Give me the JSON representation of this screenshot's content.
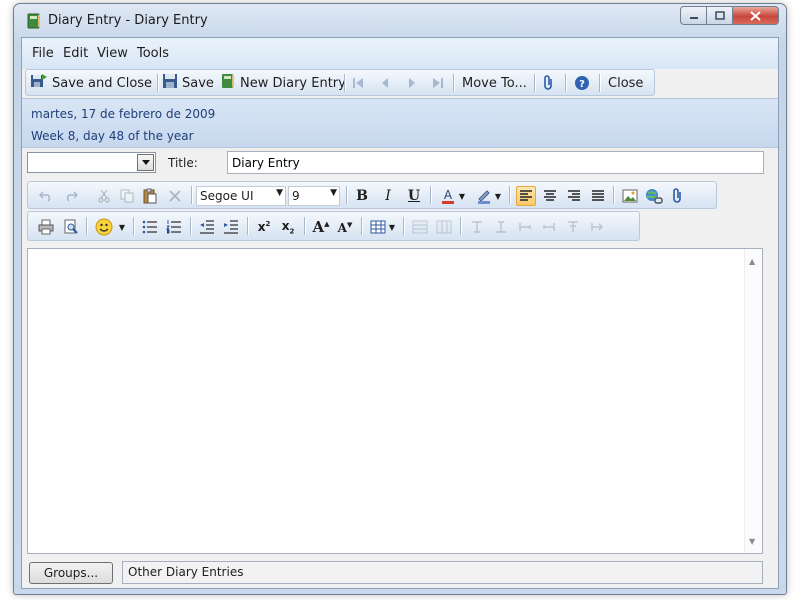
{
  "window": {
    "title": "Diary Entry - Diary Entry"
  },
  "menu": {
    "file": "File",
    "edit": "Edit",
    "view": "View",
    "tools": "Tools"
  },
  "toolbar": {
    "save_and_close": "Save and Close",
    "save": "Save",
    "new_diary_entry": "New Diary Entry",
    "move_to": "Move To...",
    "close": "Close"
  },
  "info": {
    "date": "martes, 17 de febrero de 2009",
    "week": "Week 8, day 48 of the year"
  },
  "form": {
    "category_value": "",
    "title_label": "Title:",
    "title_value": "Diary Entry"
  },
  "format": {
    "font_name": "Segoe UI",
    "font_size": "9"
  },
  "footer": {
    "groups_button": "Groups...",
    "groups_value": "Other Diary Entries"
  },
  "colors": {
    "accent": "#1f3f7a",
    "font_color": "#d23a2a",
    "active_align": "#f8c966"
  },
  "icons": [
    "diary-book-icon",
    "save-close-icon",
    "save-icon",
    "new-entry-icon",
    "first-icon",
    "prev-icon",
    "next-icon",
    "last-icon",
    "paperclip-icon",
    "help-icon",
    "undo-icon",
    "redo-icon",
    "cut-icon",
    "copy-icon",
    "paste-icon",
    "delete-icon",
    "bold-icon",
    "italic-icon",
    "underline-icon",
    "font-color-icon",
    "highlight-icon",
    "align-left-icon",
    "align-center-icon",
    "align-right-icon",
    "justify-icon",
    "image-icon",
    "hyperlink-icon",
    "attach-icon",
    "print-icon",
    "print-preview-icon",
    "smiley-icon",
    "bullets-icon",
    "numbering-icon",
    "outdent-icon",
    "indent-icon",
    "superscript-icon",
    "subscript-icon",
    "grow-font-icon",
    "shrink-font-icon",
    "table-icon"
  ]
}
